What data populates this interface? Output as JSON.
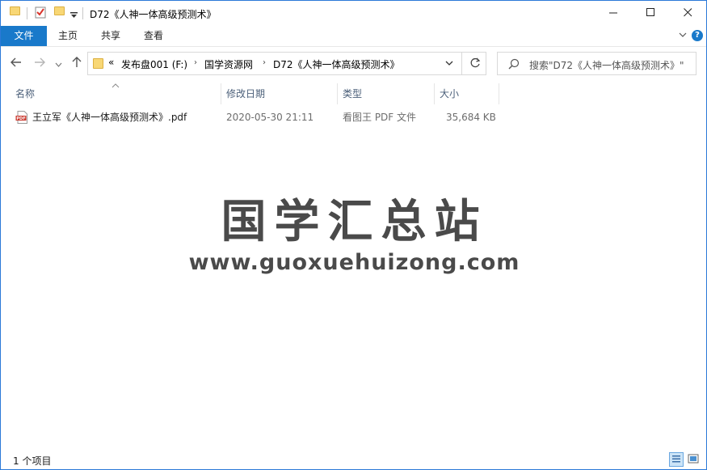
{
  "window": {
    "title": "D72《人神一体高级预测术》",
    "controls": {
      "minimize": "minimize-icon",
      "maximize": "maximize-icon",
      "close": "close-icon"
    }
  },
  "ribbon": {
    "tabs": [
      {
        "label": "文件",
        "active": true
      },
      {
        "label": "主页"
      },
      {
        "label": "共享"
      },
      {
        "label": "查看"
      }
    ],
    "accent": "#1979ca",
    "help_glyph": "?"
  },
  "address": {
    "overflow": "«",
    "segments": [
      "发布盘001 (F:)",
      "国学资源网",
      "D72《人神一体高级预测术》"
    ]
  },
  "search": {
    "placeholder": "搜索\"D72《人神一体高级预测术》\""
  },
  "columns": [
    {
      "label": "名称"
    },
    {
      "label": "修改日期"
    },
    {
      "label": "类型"
    },
    {
      "label": "大小"
    }
  ],
  "files": [
    {
      "name": "王立军《人神一体高级预测术》.pdf",
      "modified": "2020-05-30 21:11",
      "type": "看图王 PDF 文件",
      "size": "35,684 KB",
      "icon": "pdf-file-icon"
    }
  ],
  "watermark": {
    "title": "国学汇总站",
    "url": "www.guoxuehuizong.com"
  },
  "status": {
    "item_count": "1 个项目"
  }
}
